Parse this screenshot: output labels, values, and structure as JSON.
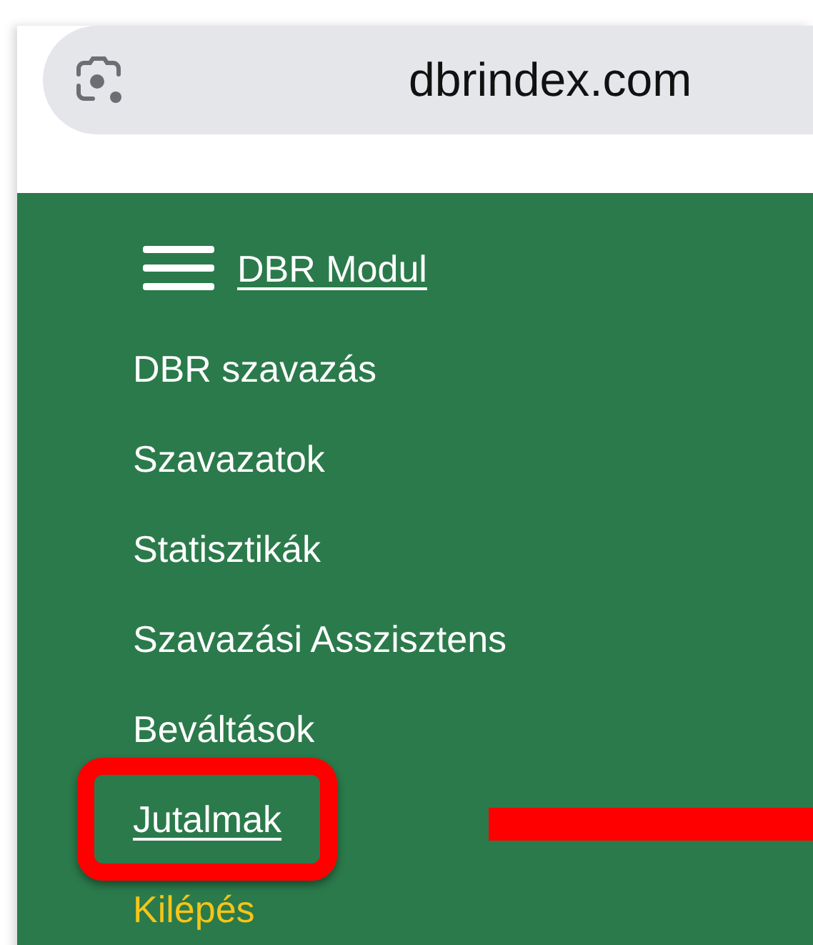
{
  "browser": {
    "address": "dbrindex.com"
  },
  "menu": {
    "title": "DBR Modul",
    "items": [
      {
        "label": "DBR szavazás",
        "kind": "link",
        "selected": false,
        "highlighted": false
      },
      {
        "label": "Szavazatok",
        "kind": "link",
        "selected": false,
        "highlighted": false
      },
      {
        "label": "Statisztikák",
        "kind": "link",
        "selected": false,
        "highlighted": false
      },
      {
        "label": "Szavazási Asszisztens",
        "kind": "link",
        "selected": false,
        "highlighted": false
      },
      {
        "label": "Beváltások",
        "kind": "link",
        "selected": false,
        "highlighted": false
      },
      {
        "label": "Jutalmak",
        "kind": "link",
        "selected": true,
        "highlighted": true
      },
      {
        "label": "Kilépés",
        "kind": "exit",
        "selected": false,
        "highlighted": false
      }
    ]
  }
}
